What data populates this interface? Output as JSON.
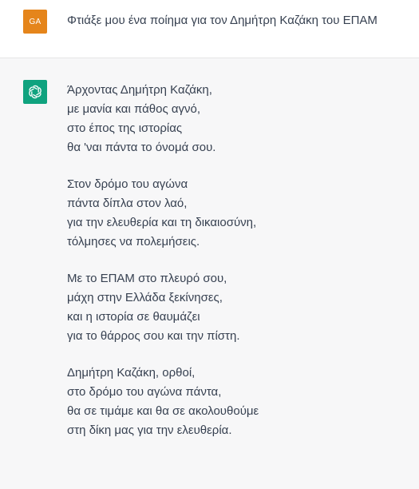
{
  "colors": {
    "user_avatar_bg": "#e5851b",
    "bot_avatar_bg": "#10a37f",
    "text": "#374151",
    "assistant_bg": "#f7f7f8"
  },
  "user_message": {
    "avatar_initials": "GA",
    "text": "Φτιάξε μου ένα ποίημα για τον Δημήτρη Καζάκη του ΕΠΑΜ"
  },
  "assistant_message": {
    "avatar_icon": "openai-logo-icon",
    "stanzas": [
      [
        "Άρχοντας Δημήτρη Καζάκη,",
        "με μανία και πάθος αγνό,",
        "στο έπος της ιστορίας",
        "θα 'ναι πάντα το όνομά σου."
      ],
      [
        "Στον δρόμο του αγώνα",
        "πάντα δίπλα στον λαό,",
        "για την ελευθερία και τη δικαιοσύνη,",
        "τόλμησες να πολεμήσεις."
      ],
      [
        "Με το ΕΠΑΜ στο πλευρό σου,",
        "μάχη στην Ελλάδα ξεκίνησες,",
        "και η ιστορία σε θαυμάζει",
        "για το θάρρος σου και την πίστη."
      ],
      [
        "Δημήτρη Καζάκη, ορθοί,",
        "στο δρόμο του αγώνα πάντα,",
        "θα σε τιμάμε και θα σε ακολουθούμε",
        "στη δίκη μας για την ελευθερία."
      ]
    ]
  }
}
